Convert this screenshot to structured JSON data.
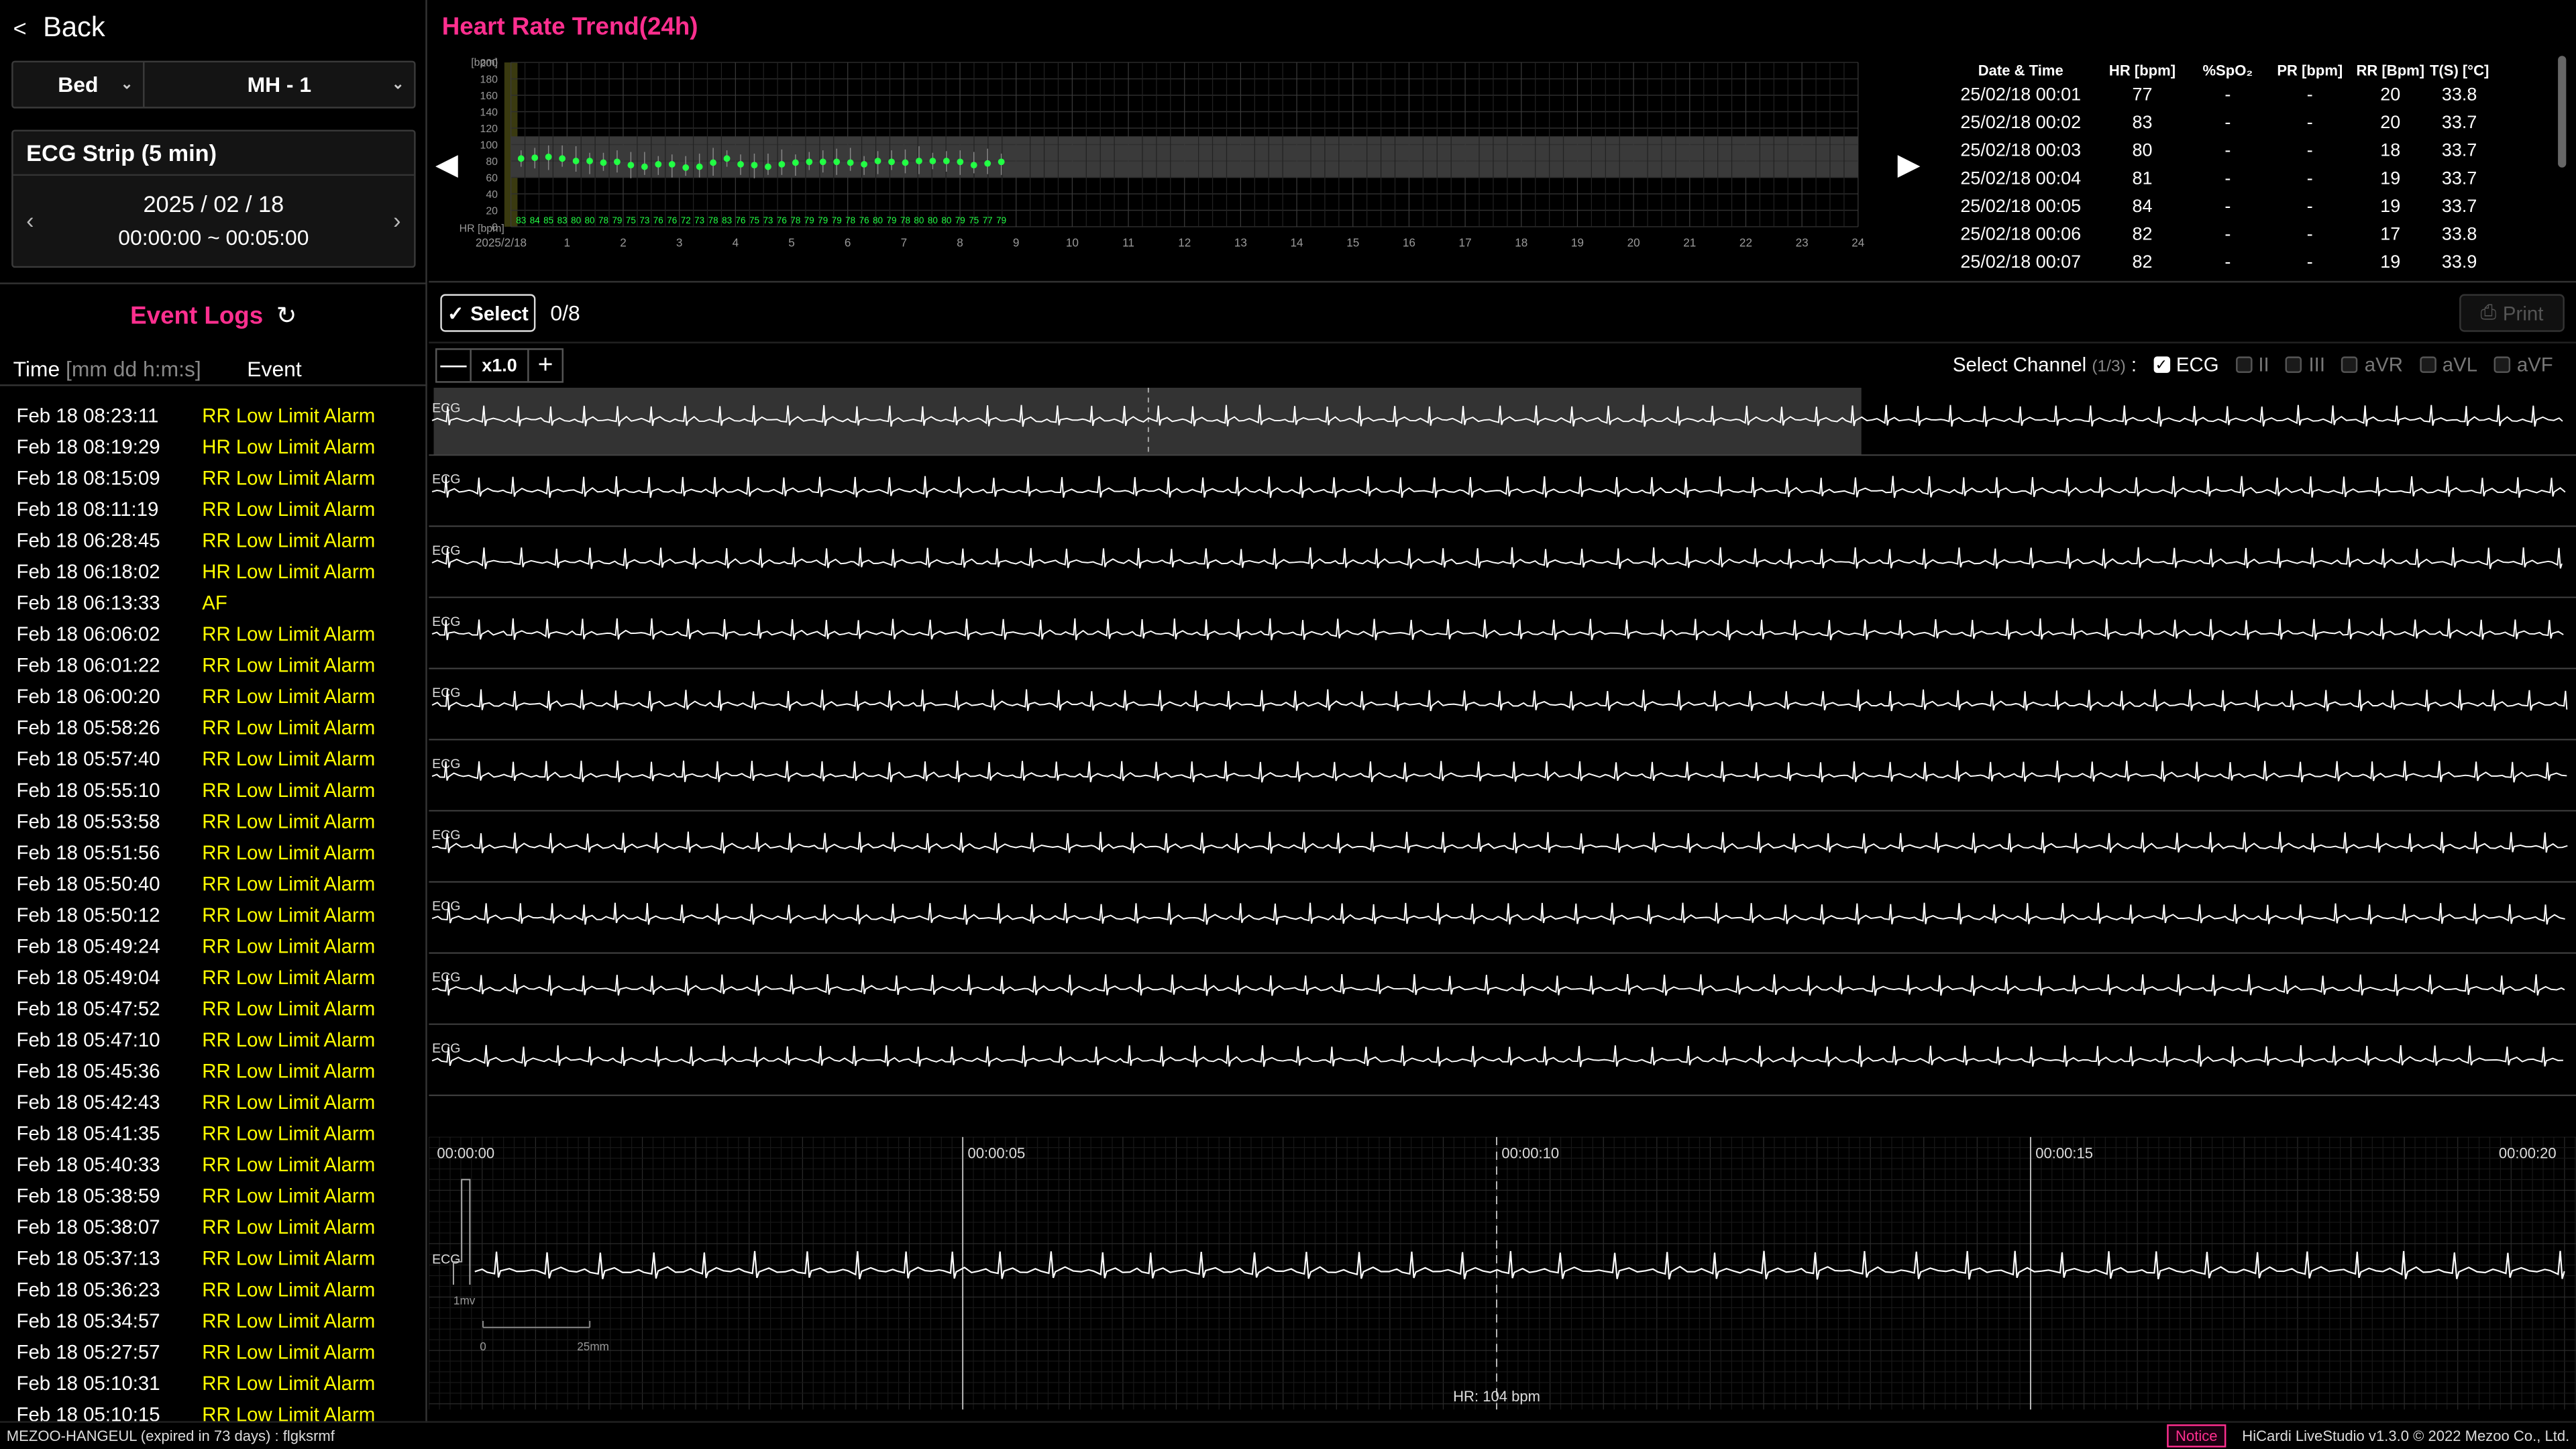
{
  "nav": {
    "back_label": "Back",
    "back_icon": "chevron-left-icon"
  },
  "bed_select": {
    "label": "Bed",
    "value": "MH - 1"
  },
  "strip": {
    "title": "ECG Strip (5 min)",
    "date": "2025 / 02 / 18",
    "time_range": "00:00:00 ~ 00:05:00"
  },
  "events": {
    "title": "Event Logs",
    "time_header": "Time",
    "time_format": "[mm dd h:m:s]",
    "event_header": "Event",
    "items": [
      {
        "time": "Feb 18 08:23:11",
        "event": "RR Low Limit Alarm"
      },
      {
        "time": "Feb 18 08:19:29",
        "event": "HR Low Limit Alarm"
      },
      {
        "time": "Feb 18 08:15:09",
        "event": "RR Low Limit Alarm"
      },
      {
        "time": "Feb 18 08:11:19",
        "event": "RR Low Limit Alarm"
      },
      {
        "time": "Feb 18 06:28:45",
        "event": "RR Low Limit Alarm"
      },
      {
        "time": "Feb 18 06:18:02",
        "event": "HR Low Limit Alarm"
      },
      {
        "time": "Feb 18 06:13:33",
        "event": "AF"
      },
      {
        "time": "Feb 18 06:06:02",
        "event": "RR Low Limit Alarm"
      },
      {
        "time": "Feb 18 06:01:22",
        "event": "RR Low Limit Alarm"
      },
      {
        "time": "Feb 18 06:00:20",
        "event": "RR Low Limit Alarm"
      },
      {
        "time": "Feb 18 05:58:26",
        "event": "RR Low Limit Alarm"
      },
      {
        "time": "Feb 18 05:57:40",
        "event": "RR Low Limit Alarm"
      },
      {
        "time": "Feb 18 05:55:10",
        "event": "RR Low Limit Alarm"
      },
      {
        "time": "Feb 18 05:53:58",
        "event": "RR Low Limit Alarm"
      },
      {
        "time": "Feb 18 05:51:56",
        "event": "RR Low Limit Alarm"
      },
      {
        "time": "Feb 18 05:50:40",
        "event": "RR Low Limit Alarm"
      },
      {
        "time": "Feb 18 05:50:12",
        "event": "RR Low Limit Alarm"
      },
      {
        "time": "Feb 18 05:49:24",
        "event": "RR Low Limit Alarm"
      },
      {
        "time": "Feb 18 05:49:04",
        "event": "RR Low Limit Alarm"
      },
      {
        "time": "Feb 18 05:47:52",
        "event": "RR Low Limit Alarm"
      },
      {
        "time": "Feb 18 05:47:10",
        "event": "RR Low Limit Alarm"
      },
      {
        "time": "Feb 18 05:45:36",
        "event": "RR Low Limit Alarm"
      },
      {
        "time": "Feb 18 05:42:43",
        "event": "RR Low Limit Alarm"
      },
      {
        "time": "Feb 18 05:41:35",
        "event": "RR Low Limit Alarm"
      },
      {
        "time": "Feb 18 05:40:33",
        "event": "RR Low Limit Alarm"
      },
      {
        "time": "Feb 18 05:38:59",
        "event": "RR Low Limit Alarm"
      },
      {
        "time": "Feb 18 05:38:07",
        "event": "RR Low Limit Alarm"
      },
      {
        "time": "Feb 18 05:37:13",
        "event": "RR Low Limit Alarm"
      },
      {
        "time": "Feb 18 05:36:23",
        "event": "RR Low Limit Alarm"
      },
      {
        "time": "Feb 18 05:34:57",
        "event": "RR Low Limit Alarm"
      },
      {
        "time": "Feb 18 05:27:57",
        "event": "RR Low Limit Alarm"
      },
      {
        "time": "Feb 18 05:10:31",
        "event": "RR Low Limit Alarm"
      },
      {
        "time": "Feb 18 05:10:15",
        "event": "RR Low Limit Alarm"
      }
    ]
  },
  "trend": {
    "title": "Heart Rate Trend(24h)",
    "unit_label": "[bpm]",
    "hr_label": "HR [bpm]",
    "date_label": "2025/2/18",
    "hr_values": [
      "83",
      "84",
      "85",
      "83",
      "80",
      "80",
      "78",
      "79",
      "75",
      "73",
      "76",
      "76",
      "72",
      "73",
      "78",
      "83",
      "76",
      "75",
      "73",
      "76",
      "78",
      "79",
      "79",
      "79",
      "78",
      "76",
      "80",
      "79",
      "78",
      "80",
      "80",
      "80",
      "79",
      "75",
      "77",
      "79"
    ]
  },
  "chart_data": {
    "type": "scatter",
    "title": "Heart Rate Trend(24h)",
    "xlabel": "",
    "ylabel": "[bpm]",
    "ylim": [
      0,
      200
    ],
    "xlim": [
      0,
      24
    ],
    "yticks": [
      0,
      20,
      40,
      60,
      80,
      100,
      120,
      140,
      160,
      180,
      200
    ],
    "xticks": [
      "1",
      "2",
      "3",
      "4",
      "5",
      "6",
      "7",
      "8",
      "9",
      "10",
      "11",
      "12",
      "13",
      "14",
      "15",
      "16",
      "17",
      "18",
      "19",
      "20",
      "21",
      "22",
      "23",
      "24"
    ],
    "normal_band": [
      60,
      110
    ],
    "series": [
      {
        "name": "HR",
        "values": [
          83,
          84,
          85,
          83,
          80,
          80,
          78,
          79,
          75,
          73,
          76,
          76,
          72,
          73,
          78,
          83,
          76,
          75,
          73,
          76,
          78,
          79,
          79,
          79,
          78,
          76,
          80,
          79,
          78,
          80,
          80,
          80,
          79,
          75,
          77,
          79
        ]
      }
    ],
    "grid": true
  },
  "vitals_table": {
    "headers": [
      "Date & Time",
      "HR [bpm]",
      "%SpO₂",
      "PR [bpm]",
      "RR [Bpm]",
      "T(S) [°C]"
    ],
    "rows": [
      [
        "25/02/18 00:01",
        "77",
        "-",
        "-",
        "20",
        "33.8"
      ],
      [
        "25/02/18 00:02",
        "83",
        "-",
        "-",
        "20",
        "33.7"
      ],
      [
        "25/02/18 00:03",
        "80",
        "-",
        "-",
        "18",
        "33.7"
      ],
      [
        "25/02/18 00:04",
        "81",
        "-",
        "-",
        "19",
        "33.7"
      ],
      [
        "25/02/18 00:05",
        "84",
        "-",
        "-",
        "19",
        "33.7"
      ],
      [
        "25/02/18 00:06",
        "82",
        "-",
        "-",
        "17",
        "33.8"
      ],
      [
        "25/02/18 00:07",
        "82",
        "-",
        "-",
        "19",
        "33.9"
      ]
    ]
  },
  "toolbar": {
    "select_label": "Select",
    "select_count": "0/8",
    "print_label": "Print",
    "zoom_value": "x1.0"
  },
  "channels": {
    "label": "Select Channel",
    "count": "(1/3)",
    "colon": ":",
    "items": [
      {
        "name": "ECG",
        "checked": true
      },
      {
        "name": "II",
        "checked": false
      },
      {
        "name": "III",
        "checked": false
      },
      {
        "name": "aVR",
        "checked": false
      },
      {
        "name": "aVL",
        "checked": false
      },
      {
        "name": "aVF",
        "checked": false
      }
    ]
  },
  "strips": {
    "lead_label": "ECG",
    "count": 10
  },
  "detail": {
    "times": [
      "00:00:00",
      "00:00:05",
      "00:00:10",
      "00:00:15",
      "00:00:20"
    ],
    "lead_label": "ECG",
    "cal_label": "1mv",
    "scale_start": "0",
    "scale_end": "25mm",
    "hr_text": "HR: 104 bpm"
  },
  "footer": {
    "license": "MEZOO-HANGEUL (expired in 73 days) : flgksrmf",
    "notice": "Notice",
    "version": "HiCardi LiveStudio v1.3.0 © 2022 Mezoo Co., Ltd."
  },
  "colors": {
    "accent": "#ff2f8f",
    "alarm": "#ffff00",
    "trend_point": "#22ff44",
    "band": "#3a3a3a"
  }
}
